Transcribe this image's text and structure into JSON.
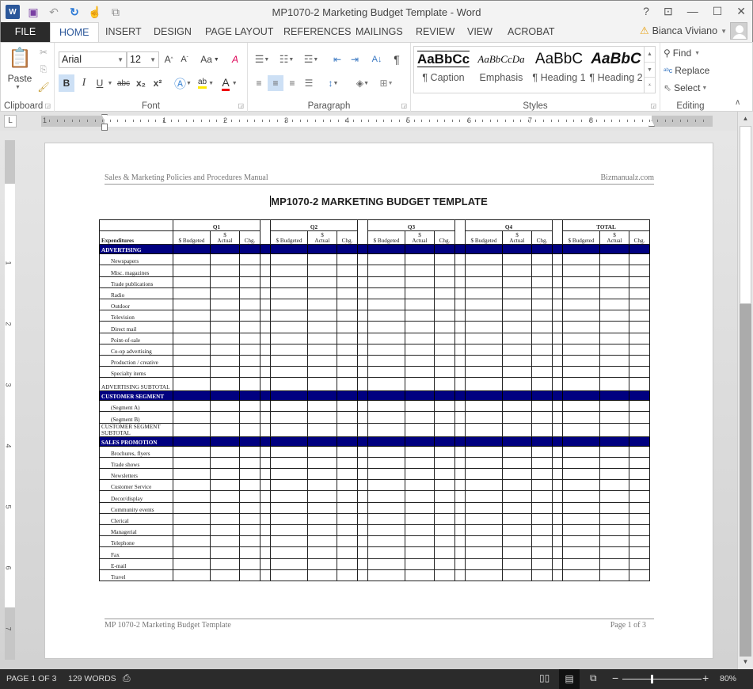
{
  "window": {
    "title": "MP1070-2 Marketing Budget Template - Word",
    "controls": {
      "help": "?",
      "ribbon_options": "⊡",
      "minimize": "—",
      "maximize": "☐",
      "close": "✕"
    }
  },
  "quick_access": {
    "word_icon": "W",
    "save": "💾",
    "undo": "↶",
    "redo": "↻",
    "touch": "☝",
    "more": "⧉"
  },
  "tabs": [
    "FILE",
    "HOME",
    "INSERT",
    "DESIGN",
    "PAGE LAYOUT",
    "REFERENCES",
    "MAILINGS",
    "REVIEW",
    "VIEW",
    "ACROBAT"
  ],
  "active_tab": "HOME",
  "user": {
    "name": "Bianca Viviano"
  },
  "ribbon": {
    "clipboard": {
      "label": "Clipboard",
      "paste": "Paste"
    },
    "font": {
      "label": "Font",
      "font_name": "Arial",
      "font_size": "12",
      "grow": "A",
      "shrink": "A",
      "change_case": "Aa",
      "bold": "B",
      "italic": "I",
      "underline": "U",
      "strikethrough": "abc",
      "subscript": "x₂",
      "superscript": "x²"
    },
    "paragraph": {
      "label": "Paragraph",
      "pilcrow": "¶"
    },
    "styles": {
      "label": "Styles",
      "items": [
        {
          "preview": "AaBbCc",
          "name": "¶ Caption"
        },
        {
          "preview": "AaBbCcDa",
          "name": "Emphasis"
        },
        {
          "preview": "AaBbC",
          "name": "¶ Heading 1"
        },
        {
          "preview": "AaBbC",
          "name": "¶ Heading 2"
        }
      ]
    },
    "editing": {
      "label": "Editing",
      "find": "Find",
      "replace": "Replace",
      "select": "Select"
    }
  },
  "ruler": {
    "numbers": [
      "1",
      "1",
      "2",
      "3",
      "4",
      "5",
      "6",
      "7",
      "8"
    ],
    "vnumbers": [
      "1",
      "2",
      "3",
      "4",
      "5",
      "6",
      "7"
    ],
    "tab_selector": "L"
  },
  "document": {
    "header_left": "Sales & Marketing Policies and Procedures Manual",
    "header_right": "Bizmanualz.com",
    "title": "MP1070-2 MARKETING BUDGET TEMPLATE",
    "footer_left": "MP 1070-2 Marketing Budget Template",
    "footer_right": "Page 1 of 3",
    "table": {
      "periods": [
        "Q1",
        "Q2",
        "Q3",
        "Q4",
        "TOTAL"
      ],
      "first_col_header": "Expenditures",
      "sub_headers": {
        "budgeted": "$ Budgeted",
        "actual_top": "$",
        "actual": "Actual",
        "chg": "Chg."
      },
      "sections": [
        {
          "title": "ADVERTISING",
          "items": [
            "Newspapers",
            "Misc. magazines",
            "Trade publications",
            "Radio",
            "Outdoor",
            "Television",
            "Direct mail",
            "Point-of-sale",
            "Co-op advertising",
            "Production / creative",
            "Specialty items"
          ],
          "subtotal": "ADVERTISING SUBTOTAL"
        },
        {
          "title": "CUSTOMER SEGMENT",
          "items": [
            "(Segment A)",
            "(Segment B)"
          ],
          "subtotal": "CUSTOMER SEGMENT SUBTOTAL"
        },
        {
          "title": "SALES PROMOTION",
          "items": [
            "Brochures, flyers",
            "Trade shows",
            "Newsletters",
            "Customer Service",
            "Decor/display",
            "Community events",
            "Clerical",
            "Managerial",
            "Telephone",
            "Fax",
            "E-mail",
            "Travel"
          ],
          "subtotal": null
        }
      ]
    }
  },
  "statusbar": {
    "page": "PAGE 1 OF 3",
    "words": "129 WORDS",
    "zoom": "80%",
    "zoom_minus": "−",
    "zoom_plus": "+"
  },
  "colors": {
    "section_band": "#000080",
    "word_blue": "#2b579a",
    "statusbar": "#2b2b2b"
  }
}
